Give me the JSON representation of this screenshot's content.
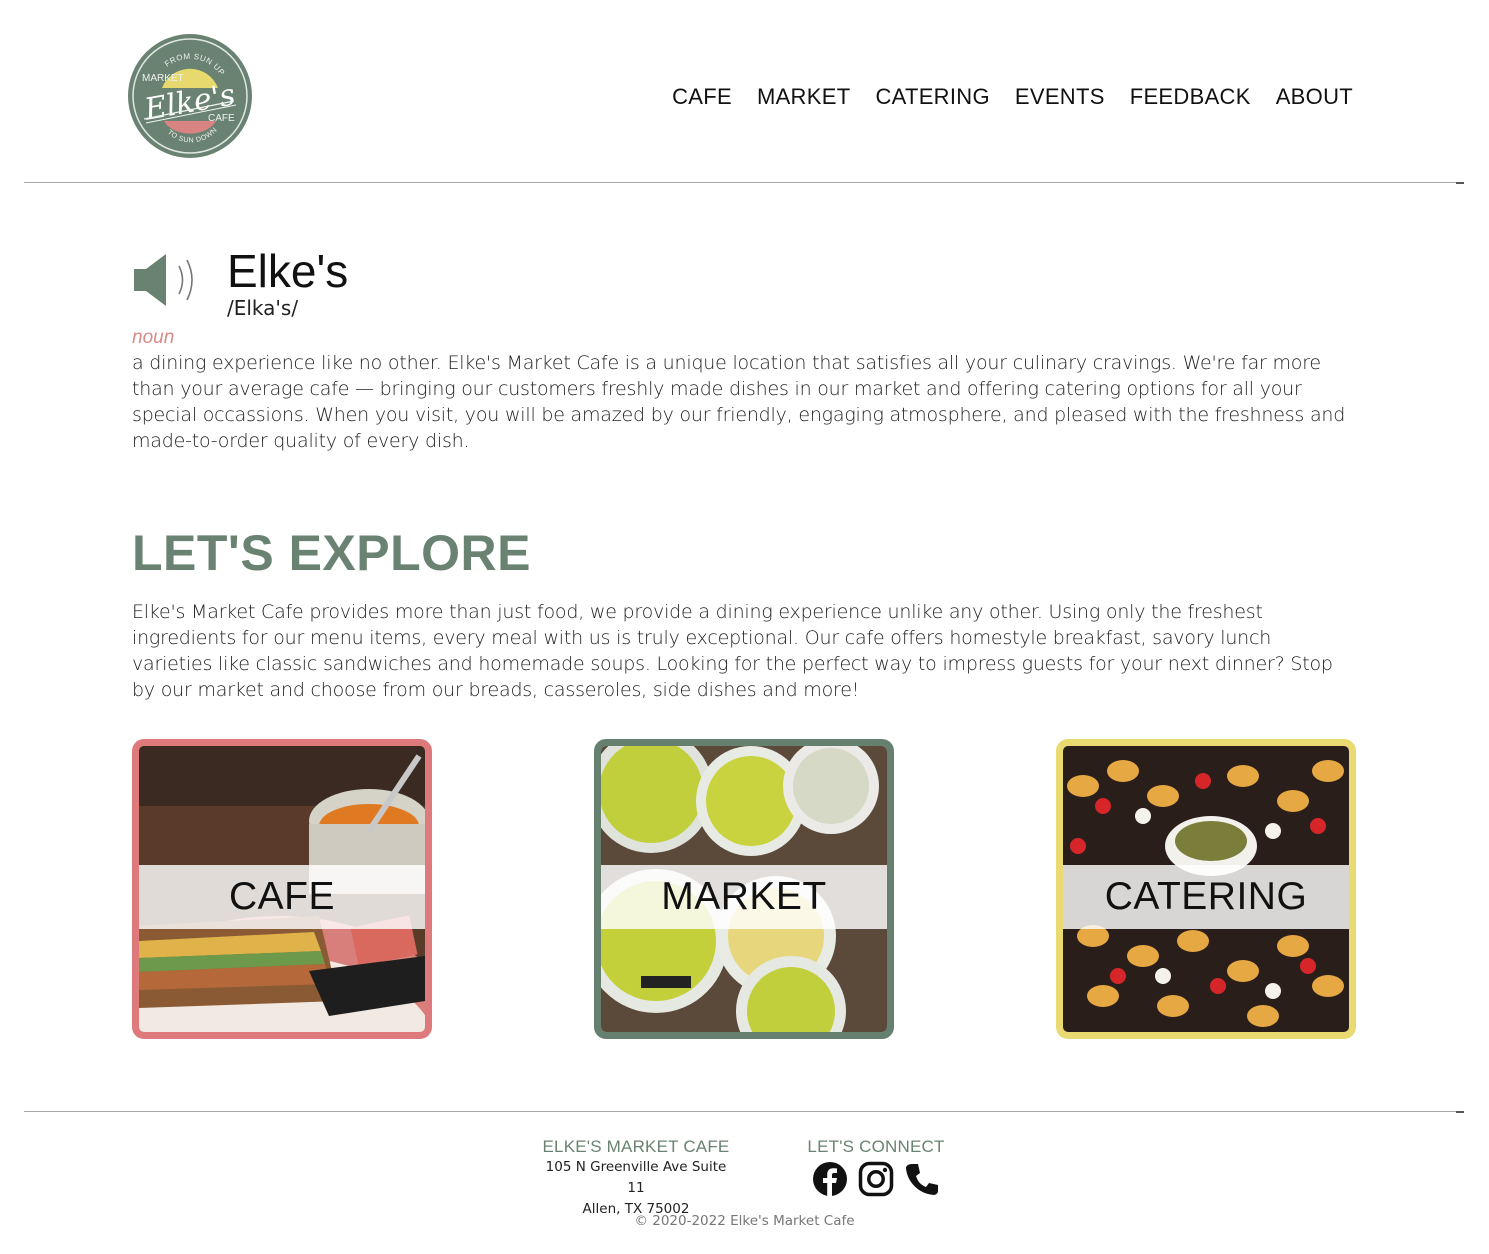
{
  "brand": {
    "logo_text": "Elke's",
    "logo_top": "FROM SUN UP",
    "logo_bottom": "TO SUN DOWN",
    "logo_left": "MARKET",
    "logo_right": "CAFE"
  },
  "nav": {
    "items": [
      "CAFE",
      "MARKET",
      "CATERING",
      "EVENTS",
      "FEEDBACK",
      "ABOUT"
    ]
  },
  "definition": {
    "word": "Elke's",
    "phonetic": "/Elka's/",
    "part_of_speech": "noun",
    "text": "a dining experience like no other. Elke's Market Cafe is a unique location that satisfies all your culinary cravings. We're far more than your average cafe — bringing our customers freshly made dishes in our market and offering catering options for all your special occassions. When you visit, you will be amazed by our friendly, engaging atmosphere, and pleased with the freshness and made-to-order quality of every dish."
  },
  "explore": {
    "title": "LET'S EXPLORE",
    "text": "Elke's Market Cafe provides more than just food, we provide a dining experience unlike any other. Using only the freshest ingredients for our menu items, every meal with us is truly exceptional. Our cafe offers homestyle breakfast, savory lunch varieties like classic sandwiches and homemade soups. Looking for the perfect way to impress guests for your next dinner? Stop by our market and choose from our breads, casseroles, side dishes and more!"
  },
  "cards": [
    {
      "label": "CAFE",
      "border_color": "#de7a7b"
    },
    {
      "label": "MARKET",
      "border_color": "#66806f"
    },
    {
      "label": "CATERING",
      "border_color": "#e9da72"
    }
  ],
  "footer": {
    "name": "ELKE'S MARKET CAFE",
    "address_line1": "105 N Greenville Ave Suite 11",
    "address_line2": "Allen, TX 75002",
    "connect": "LET'S CONNECT",
    "icons": [
      "facebook-icon",
      "instagram-icon",
      "phone-icon"
    ],
    "copyright": "© 2020-2022 Elke's Market Cafe"
  },
  "colors": {
    "sage": "#6a8272",
    "rose": "#de7a7b",
    "yellow": "#e9da72",
    "noun": "#d98a88"
  }
}
